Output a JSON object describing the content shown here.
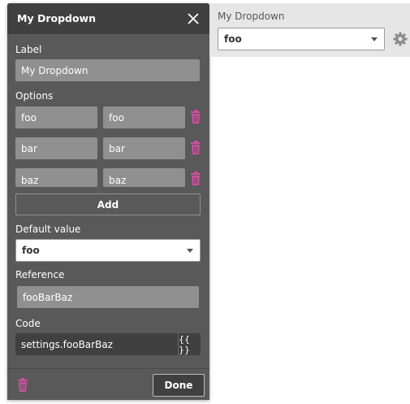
{
  "panel": {
    "title": "My Dropdown",
    "label_section": "Label",
    "label_value": "My Dropdown",
    "options_section": "Options",
    "options": [
      {
        "key": "foo",
        "value": "foo"
      },
      {
        "key": "bar",
        "value": "bar"
      },
      {
        "key": "baz",
        "value": "baz"
      }
    ],
    "add_label": "Add",
    "default_section": "Default value",
    "default_value": "foo",
    "reference_section": "Reference",
    "reference_value": "fooBarBaz",
    "code_section": "Code",
    "code_value": "settings.fooBarBaz",
    "code_button_label": "{{ }}",
    "done_label": "Done",
    "trash_color": "#d04fa0"
  },
  "preview": {
    "label": "My Dropdown",
    "selected": "foo"
  }
}
